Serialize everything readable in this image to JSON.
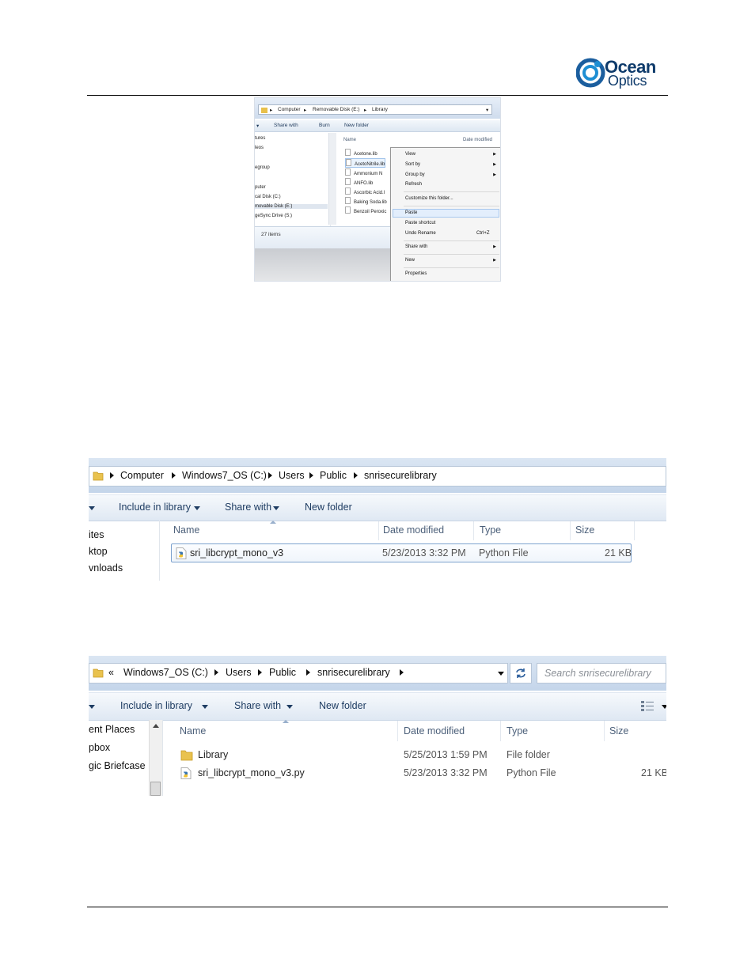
{
  "header": {
    "logo_line1": "Ocean",
    "logo_line2": "Optics"
  },
  "shot1": {
    "breadcrumb": [
      "Computer",
      "Removable Disk (E:)",
      "Library"
    ],
    "toolbar": [
      "Share with",
      "Burn",
      "New folder"
    ],
    "nav_items": [
      "tures",
      "leos",
      "egroup",
      "puter",
      "cal Disk (C:)",
      "movable Disk (E:)",
      "geSync Drive (S:)"
    ],
    "columns": {
      "name": "Name",
      "date": "Date modified"
    },
    "files": [
      "Acetone.lib",
      "AcetoNitrile.lib",
      "Ammonium N",
      "ANFO.lib",
      "Ascorbic Acid.l",
      "Baking Soda.lib",
      "Benzoil Peroxic"
    ],
    "status": "27 items",
    "context_menu": {
      "view": "View",
      "sort_by": "Sort by",
      "group_by": "Group by",
      "refresh": "Refresh",
      "customize": "Customize this folder...",
      "paste": "Paste",
      "paste_shortcut": "Paste shortcut",
      "undo_rename": "Undo Rename",
      "undo_shortcut": "Ctrl+Z",
      "share_with": "Share with",
      "new": "New",
      "properties": "Properties"
    }
  },
  "shot2": {
    "breadcrumb": [
      "Computer",
      "Windows7_OS (C:)",
      "Users",
      "Public",
      "snrisecurelibrary"
    ],
    "toolbar": {
      "include": "Include in library",
      "share": "Share with",
      "new_folder": "New folder"
    },
    "nav_items": [
      "ites",
      "ktop",
      "vnloads"
    ],
    "columns": {
      "name": "Name",
      "date": "Date modified",
      "type": "Type",
      "size": "Size"
    },
    "row": {
      "name": "sri_libcrypt_mono_v3",
      "date": "5/23/2013 3:32 PM",
      "type": "Python File",
      "size": "21 KB"
    }
  },
  "shot3": {
    "breadcrumb_prefix": "«",
    "breadcrumb": [
      "Windows7_OS (C:)",
      "Users",
      "Public",
      "snrisecurelibrary"
    ],
    "search_placeholder": "Search snrisecurelibrary",
    "toolbar": {
      "include": "Include in library",
      "share": "Share with",
      "new_folder": "New folder"
    },
    "nav_items": [
      "ent Places",
      "pbox",
      "gic Briefcase"
    ],
    "columns": {
      "name": "Name",
      "date": "Date modified",
      "type": "Type",
      "size": "Size"
    },
    "rows": [
      {
        "name": "Library",
        "date": "5/25/2013 1:59 PM",
        "type": "File folder",
        "size": ""
      },
      {
        "name": "sri_libcrypt_mono_v3.py",
        "date": "5/23/2013 3:32 PM",
        "type": "Python File",
        "size": "21 KB"
      }
    ]
  }
}
